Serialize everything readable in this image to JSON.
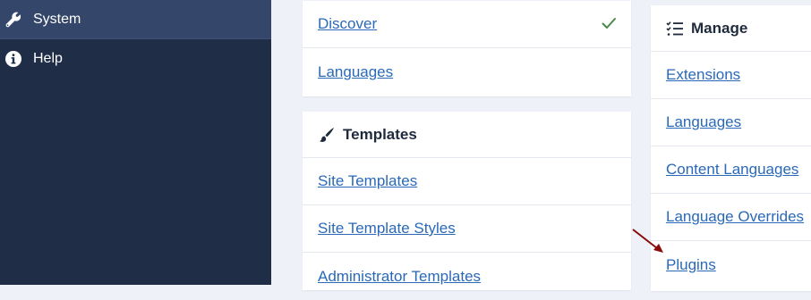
{
  "sidebar": {
    "items": [
      {
        "label": "System",
        "icon": "wrench-icon",
        "active": true
      },
      {
        "label": "Help",
        "icon": "info-icon",
        "active": false
      }
    ]
  },
  "install_card": {
    "links": [
      "Discover",
      "Languages"
    ],
    "discover_status_icon": "check-icon"
  },
  "templates_card": {
    "title": "Templates",
    "icon": "brush-icon",
    "links": [
      "Site Templates",
      "Site Template Styles",
      "Administrator Templates"
    ]
  },
  "manage_card": {
    "title": "Manage",
    "icon": "list-check-icon",
    "links": [
      "Extensions",
      "Languages",
      "Content Languages",
      "Language Overrides",
      "Plugins"
    ]
  },
  "colors": {
    "sidebar_bg": "#1f2d47",
    "sidebar_active_bg": "#34466a",
    "link": "#2a69b8",
    "check": "#4a8a4a",
    "arrow": "#8b0a0a"
  }
}
